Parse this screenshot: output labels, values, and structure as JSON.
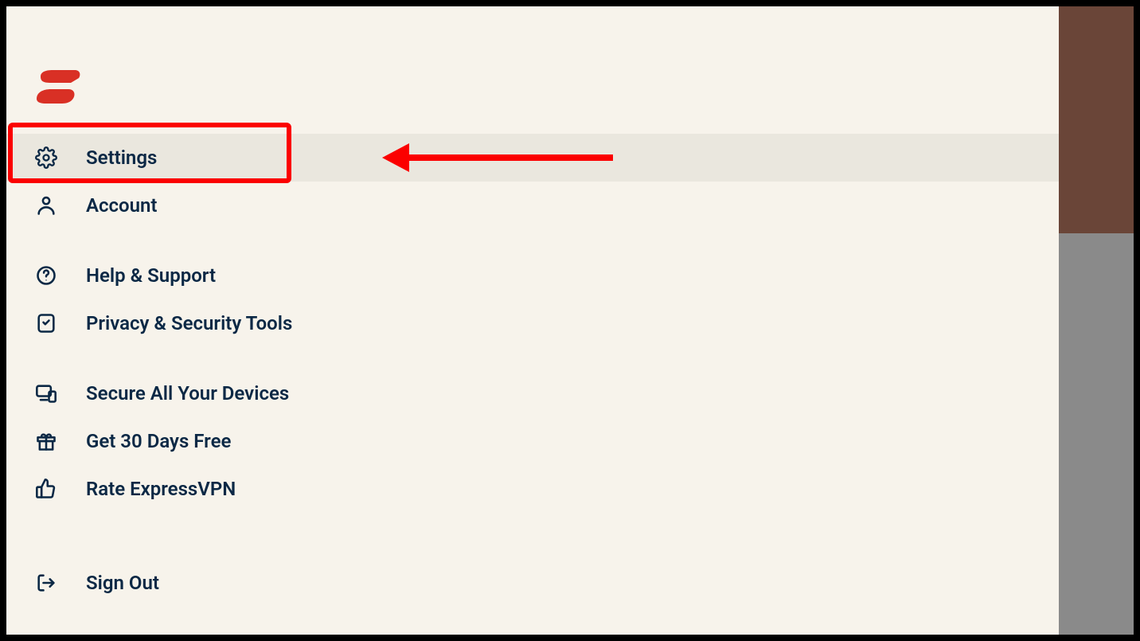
{
  "menu": {
    "settings": "Settings",
    "account": "Account",
    "help_support": "Help & Support",
    "privacy_tools": "Privacy & Security Tools",
    "secure_devices": "Secure All Your Devices",
    "get_days_free": "Get 30 Days Free",
    "rate": "Rate ExpressVPN",
    "sign_out": "Sign Out"
  },
  "colors": {
    "brand_red": "#d93025",
    "text": "#0b2845",
    "panel": "#f7f3eb",
    "selected": "#eae7de",
    "annotation": "#fb0000"
  }
}
